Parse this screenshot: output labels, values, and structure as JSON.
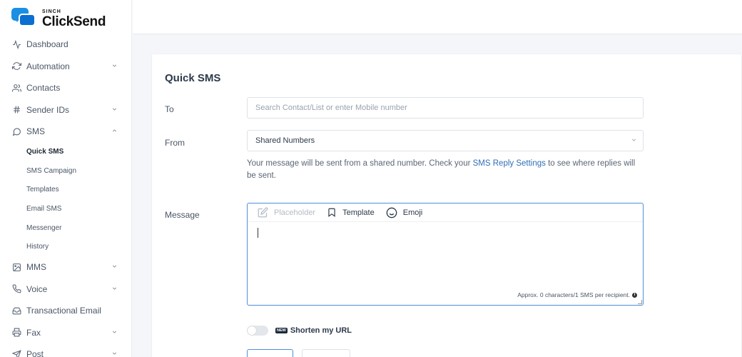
{
  "brand": {
    "small": "SINCH",
    "name": "ClickSend"
  },
  "nav": {
    "items": [
      {
        "label": "Dashboard",
        "icon": "activity-icon",
        "chevron": ""
      },
      {
        "label": "Automation",
        "icon": "refresh-icon",
        "chevron": "⌄"
      },
      {
        "label": "Contacts",
        "icon": "users-icon",
        "chevron": ""
      },
      {
        "label": "Sender IDs",
        "icon": "hash-icon",
        "chevron": "⌄"
      },
      {
        "label": "SMS",
        "icon": "message-circle-icon",
        "chevron": "⌃"
      }
    ],
    "sms_sub": [
      {
        "label": "Quick SMS"
      },
      {
        "label": "SMS Campaign"
      },
      {
        "label": "Templates"
      },
      {
        "label": "Email SMS"
      },
      {
        "label": "Messenger"
      },
      {
        "label": "History"
      }
    ],
    "items_after": [
      {
        "label": "MMS",
        "icon": "image-icon",
        "chevron": "⌄"
      },
      {
        "label": "Voice",
        "icon": "phone-icon",
        "chevron": "⌄"
      },
      {
        "label": "Transactional Email",
        "icon": "inbox-icon",
        "chevron": ""
      },
      {
        "label": "Fax",
        "icon": "printer-icon",
        "chevron": "⌄"
      },
      {
        "label": "Post",
        "icon": "send-icon",
        "chevron": "⌄"
      }
    ]
  },
  "form": {
    "title": "Quick SMS",
    "to_label": "To",
    "to_placeholder": "Search Contact/List or enter Mobile number",
    "from_label": "From",
    "from_value": "Shared Numbers",
    "help_text_1": "Your message will be sent from a shared number. Check your ",
    "help_link": "SMS Reply Settings",
    "help_text_2": " to see where replies will be sent.",
    "message_label": "Message",
    "toolbar": {
      "placeholder": "Placeholder",
      "template": "Template",
      "emoji": "Emoji"
    },
    "count_text": "Approx. 0 characters/1 SMS per recipient.",
    "shorten_badge": "NEW",
    "shorten_label": "Shorten my URL"
  },
  "colors": {
    "accent": "#4a90d9",
    "link": "#2f6fb6",
    "brand_blue": "#1a8fe3"
  }
}
